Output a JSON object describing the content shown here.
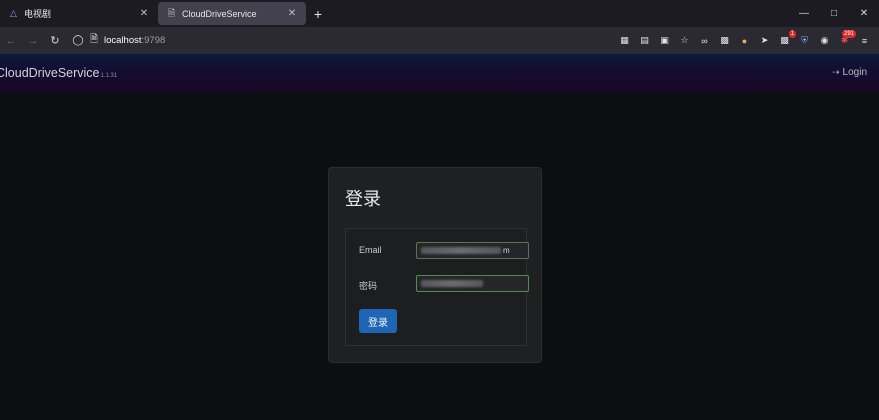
{
  "browser": {
    "tabs": [
      {
        "title": "电视剧",
        "favicon": "triangle-logo-icon",
        "active": false
      },
      {
        "title": "CloudDriveService",
        "favicon": "document-icon",
        "active": true
      }
    ],
    "url": "localhost",
    "url_port": ":9798"
  },
  "app": {
    "brand": "CloudDriveService",
    "version": "1.1.31",
    "login_label": "Login"
  },
  "login_card": {
    "title": "登录",
    "email_label": "Email",
    "email_value_tail": "m",
    "password_label": "密码",
    "submit_label": "登录"
  },
  "toolbar_badges": {
    "ext_badge": "1",
    "count_badge": "291"
  },
  "colors": {
    "page_bg": "#0d0e0f",
    "card_bg": "#1f2022",
    "primary_button": "#1f65b5",
    "password_focus_border": "#4e8d52"
  }
}
